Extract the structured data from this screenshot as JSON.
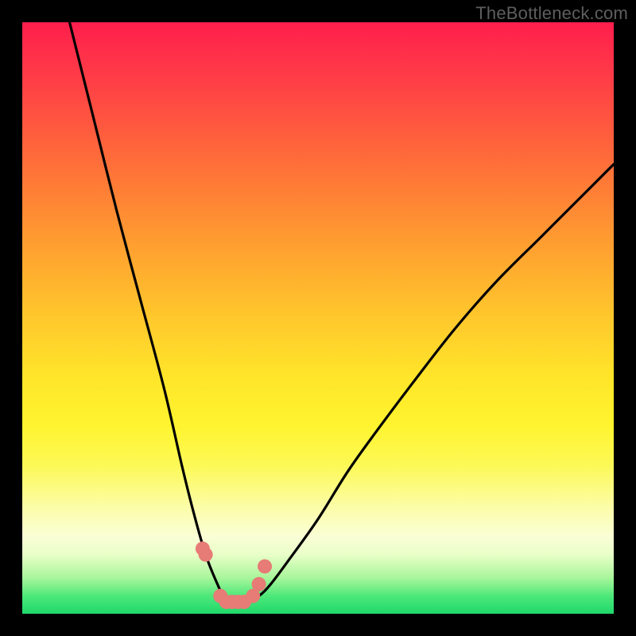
{
  "watermark": "TheBottleneck.com",
  "chart_data": {
    "type": "line",
    "title": "",
    "xlabel": "",
    "ylabel": "",
    "xlim": [
      0,
      100
    ],
    "ylim": [
      0,
      100
    ],
    "series": [
      {
        "name": "bottleneck-curve",
        "x": [
          8,
          12,
          16,
          20,
          24,
          27,
          29,
          31,
          33,
          34,
          35,
          36,
          38,
          40,
          42,
          45,
          50,
          55,
          60,
          66,
          73,
          80,
          88,
          96,
          100
        ],
        "y": [
          100,
          84,
          68,
          53,
          38,
          25,
          17,
          10,
          5,
          3,
          2,
          2,
          2,
          3,
          5,
          9,
          16,
          24,
          31,
          39,
          48,
          56,
          64,
          72,
          76
        ]
      }
    ],
    "markers": {
      "name": "highlight-dots",
      "x": [
        30.5,
        31,
        33.5,
        34.5,
        35.5,
        36.5,
        37.5,
        39,
        40,
        41
      ],
      "y": [
        11,
        10,
        3,
        2,
        2,
        2,
        2,
        3,
        5,
        8
      ]
    },
    "colors": {
      "curve": "#000000",
      "markers": "#e77b76",
      "gradient_top": "#ff1e4c",
      "gradient_bottom": "#1fd86a"
    }
  }
}
